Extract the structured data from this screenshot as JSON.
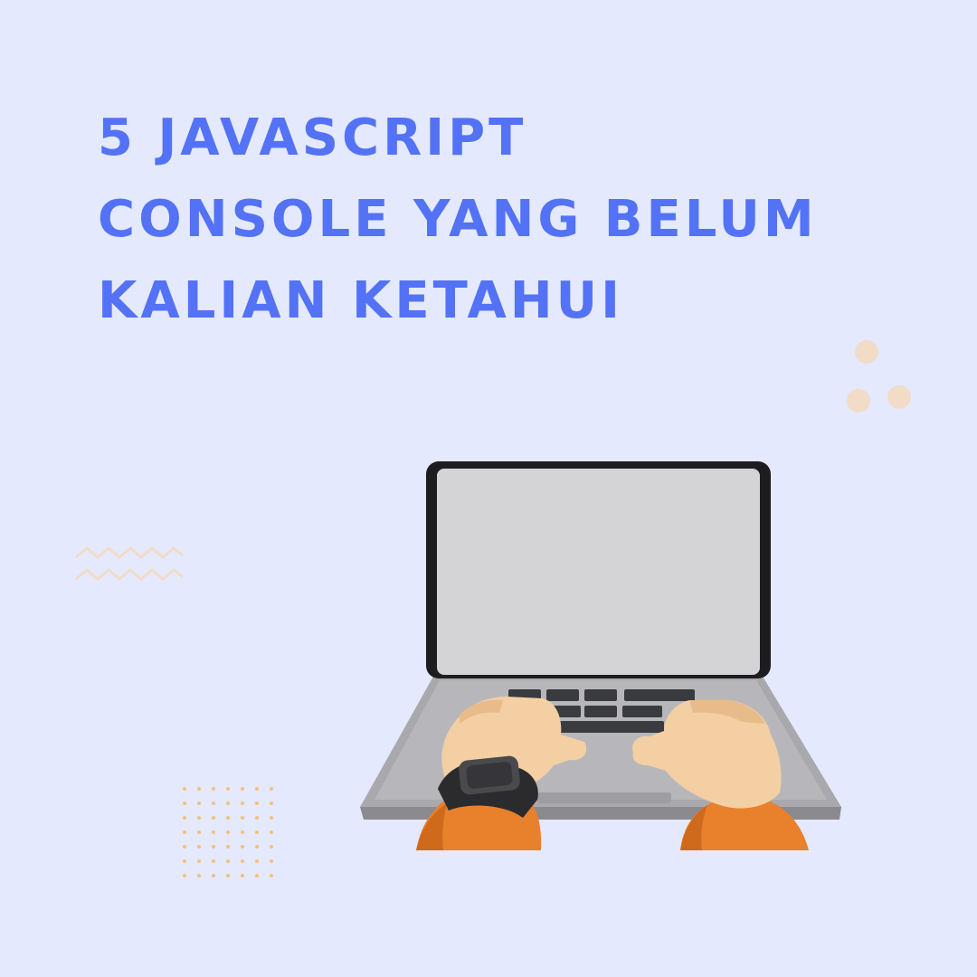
{
  "headline": {
    "lines": [
      "5 JAVASCRIPT",
      "CONSOLE YANG BELUM",
      "KALIAN KETAHUI"
    ]
  },
  "colors": {
    "background": "#e4e9fd",
    "headline": "#5472f5",
    "decor_peach": "#f2dcc8",
    "decor_dots": "#f6c07a",
    "sleeve": "#e8802c",
    "skin": "#f3cfa3",
    "screen": "#d4d4d6",
    "bezel": "#1d1d1f",
    "laptop_base": "#a9a9ad",
    "keys": "#3a3b3f"
  },
  "illustration": {
    "subject": "hands-typing-on-laptop",
    "icons": [
      "laptop-icon",
      "wristwatch-icon"
    ]
  }
}
